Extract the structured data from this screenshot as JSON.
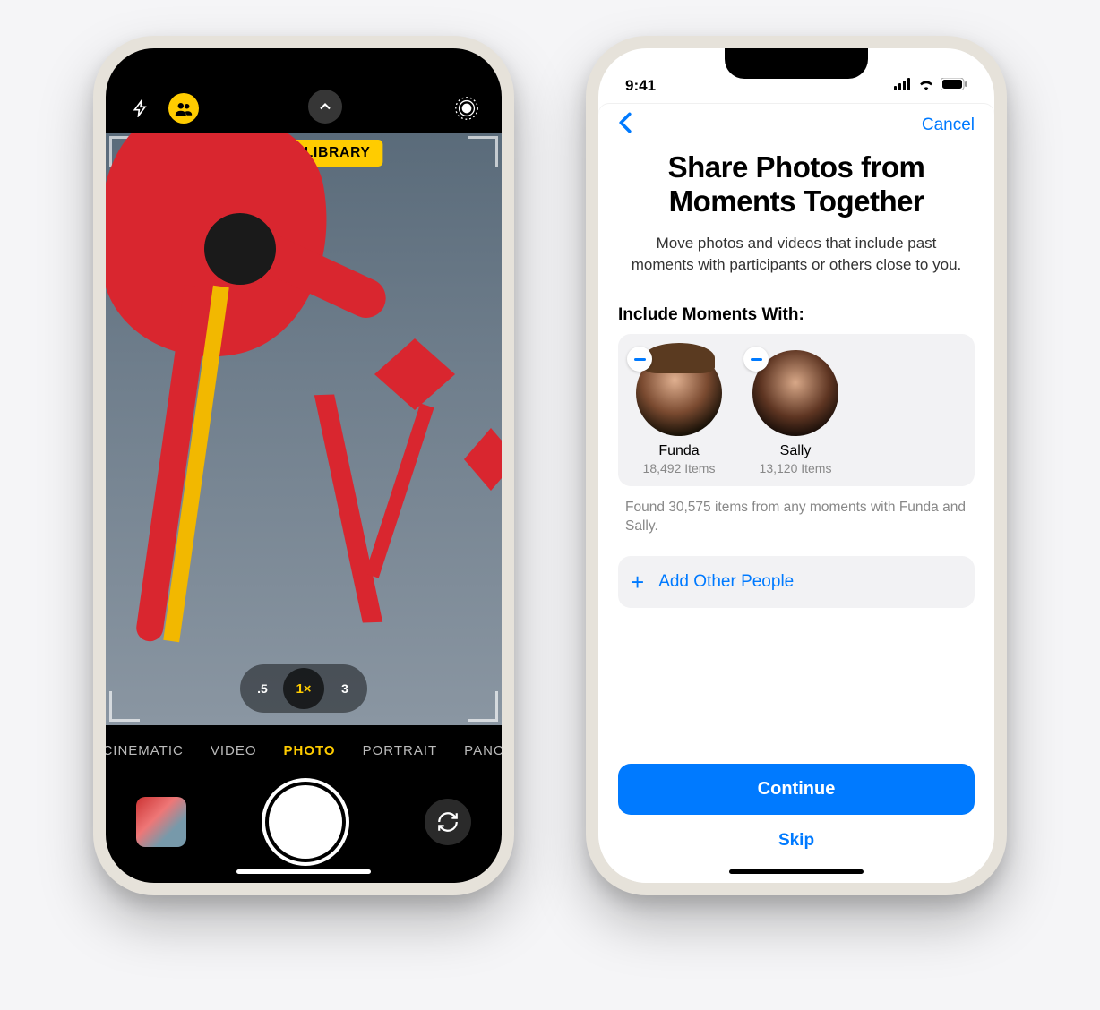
{
  "camera": {
    "shared_banner": "SHARED LIBRARY",
    "zoom": {
      "wide": ".5",
      "main": "1×",
      "tele": "3"
    },
    "modes": {
      "cinematic": "CINEMATIC",
      "video": "VIDEO",
      "photo": "PHOTO",
      "portrait": "PORTRAIT",
      "pano": "PANO"
    }
  },
  "setup": {
    "status_time": "9:41",
    "cancel": "Cancel",
    "title_line1": "Share Photos from",
    "title_line2": "Moments Together",
    "subtitle": "Move photos and videos that include past moments with participants or others close to you.",
    "include_label": "Include Moments With:",
    "people": [
      {
        "name": "Funda",
        "count_label": "18,492 Items"
      },
      {
        "name": "Sally",
        "count_label": "13,120 Items"
      }
    ],
    "found_text": "Found 30,575 items from any moments with Funda and Sally.",
    "add_label": "Add Other People",
    "continue": "Continue",
    "skip": "Skip"
  }
}
